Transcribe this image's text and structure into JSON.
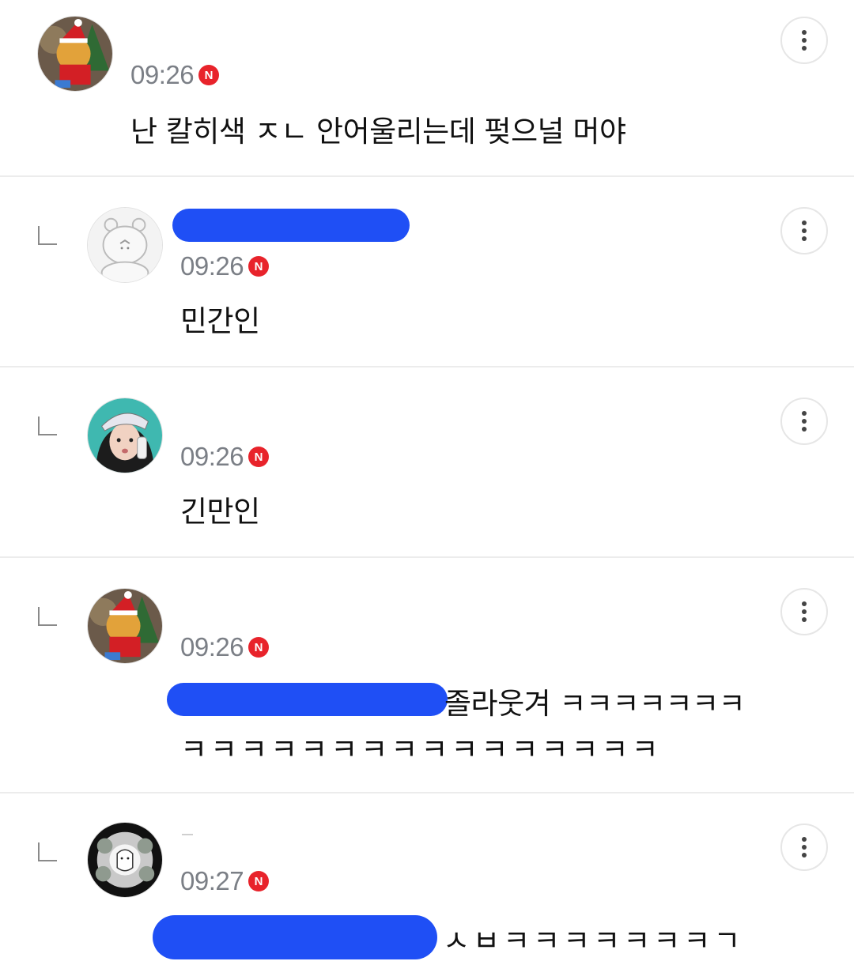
{
  "comments": [
    {
      "time": "09:26",
      "badge": "N",
      "text": "난 칼히색 ㅈㄴ 안어울리는데 펒으널 머야",
      "avatar": "winnie-pooh-santa-avatar",
      "more_icon": "more-vertical-icon"
    },
    {
      "time": "09:26",
      "badge": "N",
      "text": "민간인",
      "avatar": "cartoon-bear-avatar",
      "more_icon": "more-vertical-icon"
    },
    {
      "time": "09:26",
      "badge": "N",
      "text": "긴만인",
      "avatar": "girl-with-cap-avatar",
      "more_icon": "more-vertical-icon"
    },
    {
      "time": "09:26",
      "badge": "N",
      "text_line1": "졸라웃겨 ㅋㅋㅋㅋㅋㅋㅋ",
      "text_line2": "ㅋㅋㅋㅋㅋㅋㅋㅋㅋㅋㅋㅋㅋㅋㅋㅋ",
      "avatar": "winnie-pooh-santa-avatar",
      "more_icon": "more-vertical-icon"
    },
    {
      "time": "09:27",
      "badge": "N",
      "text": "ㅅㅂㅋㅋㅋㅋㅋㅋㅋㄱ",
      "avatar": "sheep-doodle-avatar",
      "more_icon": "more-vertical-icon"
    }
  ],
  "colors": {
    "time": "#7b7f86",
    "badge": "#e8232b",
    "redaction": "#1f4ff5",
    "divider": "#ececec"
  }
}
